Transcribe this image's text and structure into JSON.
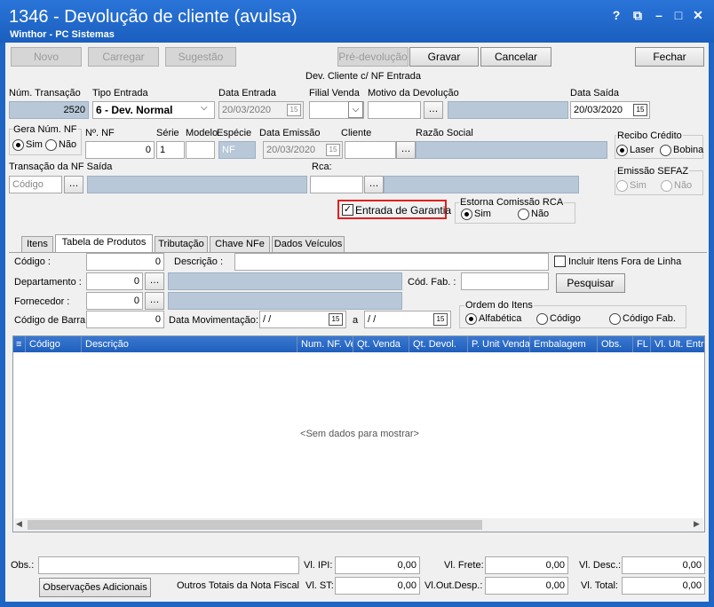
{
  "window": {
    "title": "1346 - Devolução de cliente (avulsa)",
    "subtitle": "Winthor - PC Sistemas",
    "controls": [
      "?",
      "⧉",
      "–",
      "□",
      "✕"
    ]
  },
  "toolbar": {
    "novo": "Novo",
    "carregar": "Carregar",
    "sugestao": "Sugestão",
    "pre_devolucao": "Pré-devolução",
    "gravar": "Gravar",
    "cancelar": "Cancelar",
    "fechar": "Fechar"
  },
  "header": {
    "caption": "Dev. Cliente c/ NF Entrada"
  },
  "fields": {
    "num_transacao_label": "Núm. Transação",
    "num_transacao": "2520",
    "tipo_entrada_label": "Tipo Entrada",
    "tipo_entrada": "6 - Dev. Normal",
    "data_entrada_label": "Data Entrada",
    "data_entrada": "20/03/2020",
    "filial_venda_label": "Filial Venda",
    "filial_venda": "",
    "motivo_label": "Motivo da Devolução",
    "motivo": "",
    "data_saida_label": "Data Saída",
    "data_saida": "20/03/2020",
    "gera_num_nf_label": "Gera Núm. NF",
    "sim": "Sim",
    "nao": "Não",
    "nro_nf_label": "Nº. NF",
    "nro_nf": "0",
    "serie_label": "Série",
    "serie": "1",
    "modelo_label": "Modelo",
    "modelo": "",
    "especie_label": "Espécie",
    "especie": "NF",
    "data_emissao_label": "Data Emissão",
    "data_emissao": "20/03/2020",
    "cliente_label": "Cliente",
    "cliente": "",
    "razao_social_label": "Razão Social",
    "recibo_credito_label": "Recibo Crédito",
    "laser": "Laser",
    "bobina": "Bobina",
    "transacao_nf_saida_label": "Transação da NF Saída",
    "transacao_placeholder": "Código",
    "rca_label": "Rca:",
    "emissao_sefaz_label": "Emissão SEFAZ",
    "entrada_garantia_label": "Entrada de Garantia",
    "estorna_comissao_label": "Estorna Comissão RCA"
  },
  "tabs": [
    "Itens",
    "Tabela de Produtos",
    "Tributação",
    "Chave NFe",
    "Dados Veículos"
  ],
  "filters": {
    "codigo_label": "Código :",
    "codigo": "0",
    "descricao_label": "Descrição :",
    "incluir_label": "Incluir Itens Fora de Linha",
    "departamento_label": "Departamento :",
    "departamento": "0",
    "cod_fab_label": "Cód. Fab. :",
    "pesquisar": "Pesquisar",
    "fornecedor_label": "Fornecedor :",
    "fornecedor": "0",
    "ordem_label": "Ordem do Itens",
    "alfabetica": "Alfabética",
    "ord_codigo": "Código",
    "codigo_fab": "Código Fab.",
    "codigo_barra_label": "Código de Barra:",
    "codigo_barra": "0",
    "data_mov_label": "Data Movimentação:",
    "data_mov_de": " / /",
    "a_label": "a",
    "data_mov_ate": " / /"
  },
  "grid": {
    "columns": [
      "Código",
      "Descrição",
      "Num. NF. Ve",
      "Qt. Venda",
      "Qt. Devol.",
      "P. Unit Venda",
      "Embalagem",
      "Obs.",
      "FL",
      "Vl. Ult. Entra"
    ],
    "empty_text": "<Sem dados para mostrar>"
  },
  "footer": {
    "obs_label": "Obs.:",
    "observacoes_adicionais": "Observações Adicionais",
    "outros_totais": "Outros Totais da Nota Fiscal",
    "vl_ipi_label": "Vl. IPI:",
    "vl_ipi": "0,00",
    "vl_st_label": "Vl. ST:",
    "vl_st": "0,00",
    "vl_frete_label": "Vl. Frete:",
    "vl_frete": "0,00",
    "vl_out_desp_label": "Vl.Out.Desp.:",
    "vl_out_desp": "0,00",
    "vl_desc_label": "Vl. Desc.:",
    "vl_desc": "0,00",
    "vl_total_label": "Vl. Total:",
    "vl_total": "0,00"
  }
}
